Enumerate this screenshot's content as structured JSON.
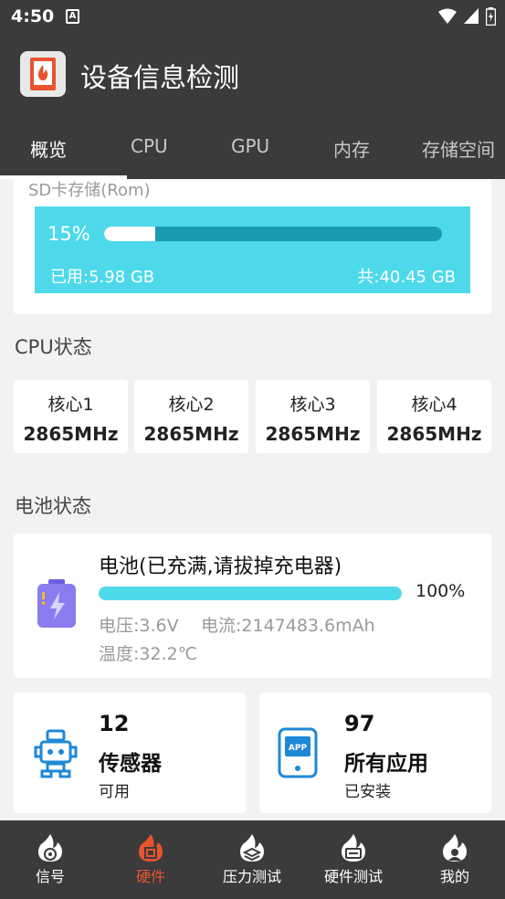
{
  "status_bar": {
    "time": "4:50",
    "notif_letter": "A"
  },
  "app": {
    "title": "设备信息检测"
  },
  "tabs": [
    {
      "label": "概览",
      "active": true
    },
    {
      "label": "CPU"
    },
    {
      "label": "GPU"
    },
    {
      "label": "内存"
    },
    {
      "label": "存储空间"
    }
  ],
  "storage": {
    "label": "SD卡存储(Rom)",
    "percent_text": "15%",
    "percent": 15,
    "used": "已用:5.98 GB",
    "total": "共:40.45 GB"
  },
  "cpu": {
    "section_title": "CPU状态",
    "cores": [
      {
        "name": "核心1",
        "freq": "2865MHz"
      },
      {
        "name": "核心2",
        "freq": "2865MHz"
      },
      {
        "name": "核心3",
        "freq": "2865MHz"
      },
      {
        "name": "核心4",
        "freq": "2865MHz"
      }
    ]
  },
  "battery": {
    "section_title": "电池状态",
    "title": "电池(已充满,请拔掉充电器)",
    "percent_text": "100%",
    "percent": 100,
    "voltage": "电压:3.6V",
    "current": "电流:2147483.6mAh",
    "temperature": "温度:32.2℃"
  },
  "sensors": {
    "count": "12",
    "label": "传感器",
    "sub": "可用",
    "icon": "robot-icon"
  },
  "apps": {
    "count": "97",
    "label": "所有应用",
    "sub": "已安装",
    "icon": "app-icon"
  },
  "bottom_nav": [
    {
      "label": "信号",
      "icon": "signal-flame-icon"
    },
    {
      "label": "硬件",
      "icon": "chip-flame-icon",
      "active": true
    },
    {
      "label": "压力测试",
      "icon": "layers-flame-icon"
    },
    {
      "label": "硬件测试",
      "icon": "device-flame-icon"
    },
    {
      "label": "我的",
      "icon": "user-flame-icon"
    }
  ],
  "colors": {
    "bar_dark": "#3b3b3b",
    "accent_cyan": "#4dd9ea",
    "active_nav": "#e8532e",
    "battery_purple": "#8a7cf0"
  }
}
